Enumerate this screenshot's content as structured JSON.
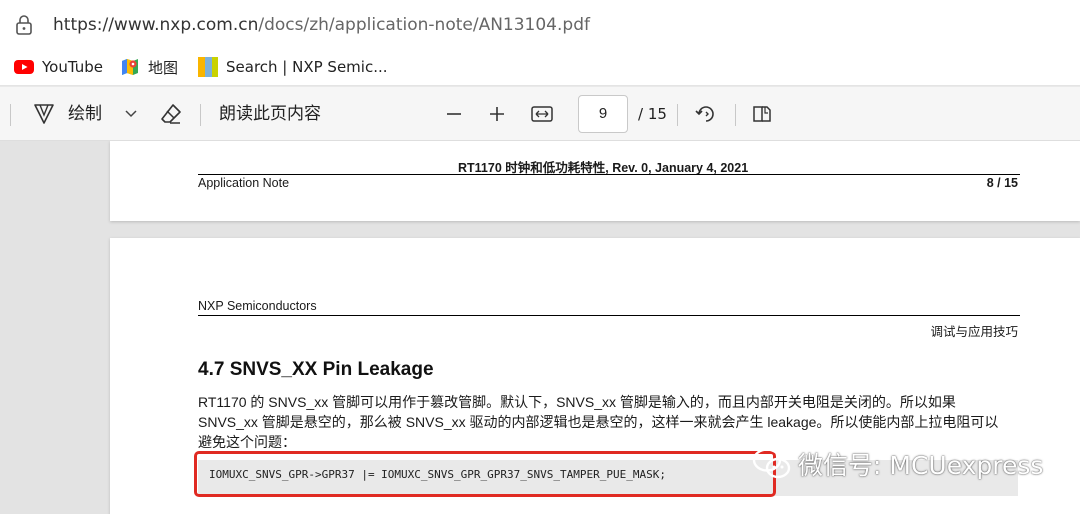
{
  "address_bar": {
    "url_host": "https://www.nxp.com.cn",
    "url_path": "/docs/zh/application-note/AN13104.pdf"
  },
  "bookmarks": [
    {
      "label": "YouTube",
      "icon": "youtube-icon"
    },
    {
      "label": "地图",
      "icon": "maps-icon"
    },
    {
      "label": "Search | NXP Semic...",
      "icon": "nxp-icon"
    }
  ],
  "toolbar": {
    "draw_label": "绘制",
    "read_aloud_label": "朗读此页内容",
    "page_current": "9",
    "page_total": "/ 15"
  },
  "page1": {
    "header_title": "RT1170 时钟和低功耗特性, Rev. 0, January 4, 2021",
    "footer_left": "Application Note",
    "footer_right": "8 / 15"
  },
  "page2": {
    "company": "NXP Semiconductors",
    "section_label": "调试与应用技巧",
    "heading": "4.7   SNVS_XX Pin Leakage",
    "paragraph_lines": [
      "RT1170 的 SNVS_xx 管脚可以用作于篡改管脚。默认下，SNVS_xx 管脚是输入的，而且内部开关电阻是关闭的。所以如果",
      "SNVS_xx 管脚是悬空的，那么被 SNVS_xx 驱动的内部逻辑也是悬空的，这样一来就会产生 leakage。所以使能内部上拉电阻可以",
      "避免这个问题："
    ],
    "code": "IOMUXC_SNVS_GPR->GPR37 |= IOMUXC_SNVS_GPR_GPR37_SNVS_TAMPER_PUE_MASK;"
  },
  "watermark": {
    "text": "微信号: MCUexpress",
    "icon": "wechat-icon"
  },
  "colors": {
    "highlight_box": "#e02a22",
    "youtube_red": "#ff0000"
  }
}
